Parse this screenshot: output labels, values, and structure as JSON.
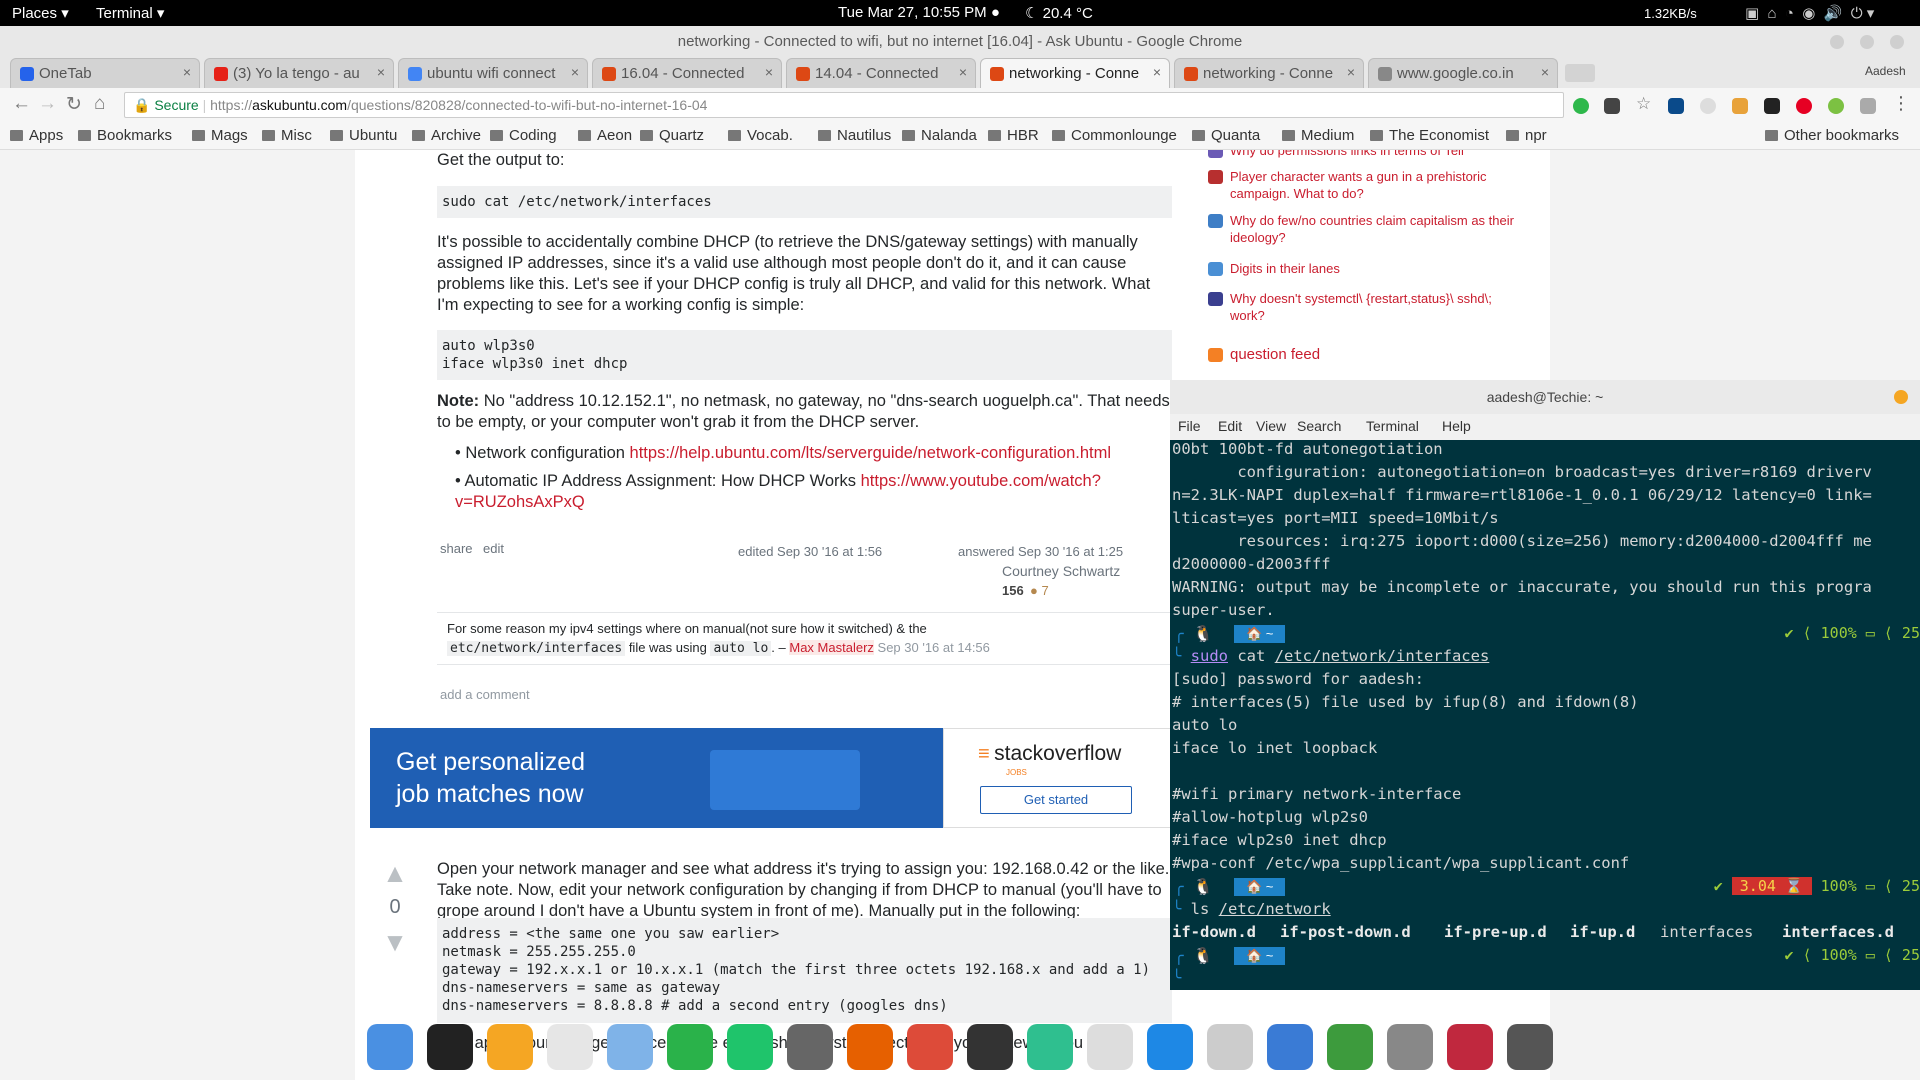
{
  "gnome": {
    "places": "Places ▾",
    "app": "Terminal ▾",
    "clock": "Tue Mar 27, 10:55 PM ●",
    "weather": "☾ 20.4 °C",
    "netspeed": "1.32KB/s"
  },
  "window_title": "networking - Connected to wifi, but no internet [16.04] - Ask Ubuntu - Google Chrome",
  "tabs": [
    {
      "label": "OneTab",
      "color": "#2563eb"
    },
    {
      "label": "(3) Yo la tengo - au",
      "color": "#e62117"
    },
    {
      "label": "ubuntu wifi connect",
      "color": "#4285f4"
    },
    {
      "label": "16.04 - Connected",
      "color": "#dd4814"
    },
    {
      "label": "14.04 - Connected",
      "color": "#dd4814"
    },
    {
      "label": "networking - Conne",
      "color": "#dd4814"
    },
    {
      "label": "networking - Conne",
      "color": "#dd4814"
    },
    {
      "label": "www.google.co.in",
      "color": "#888888"
    }
  ],
  "profile": "Aadesh",
  "omnibox": {
    "secure": "Secure",
    "scheme": "https://",
    "host": "askubuntu.com",
    "path": "/questions/820828/connected-to-wifi-but-no-internet-16-04"
  },
  "bookmarks": [
    "Apps",
    "Bookmarks",
    "Mags",
    "Misc",
    "Ubuntu",
    "Archive",
    "Coding",
    "Aeon",
    "Quartz",
    "Vocab.",
    "Nautilus",
    "Nalanda",
    "HBR",
    "Commonlounge",
    "Quanta",
    "Medium",
    "The Economist",
    "npr"
  ],
  "other_bookmarks": "Other bookmarks",
  "answer1": {
    "intro": "Get the output to:",
    "cmd": "sudo cat /etc/network/interfaces",
    "para1": "It's possible to accidentally combine DHCP (to retrieve the DNS/gateway settings) with manually assigned IP addresses, since it's a valid use although most people don't do it, and it can cause problems like this. Let's see if your DHCP config is truly all DHCP, and valid for this network. What I'm expecting to see for a working config is simple:",
    "config": "auto wlp3s0\niface wlp3s0 inet dhcp",
    "note_label": "Note:",
    "note": " No \"address 10.12.152.1\", no netmask, no gateway, no \"dns-search uoguelph.ca\". That needs to be empty, or your computer won't grab it from the DHCP server.",
    "bullet1_text": "Network configuration ",
    "bullet1_link": "https://help.ubuntu.com/lts/serverguide/network-configuration.html",
    "bullet2_text": "Automatic IP Address Assignment: How DHCP Works ",
    "bullet2_link": "https://www.youtube.com/watch?v=RUZohsAxPxQ",
    "share": "share",
    "edit": "edit",
    "edited": "edited Sep 30 '16 at 1:56",
    "answered": "answered Sep 30 '16 at 1:25",
    "author": "Courtney Schwartz",
    "rep": "156",
    "bronze": "● 7",
    "comment_text": "For some reason my ipv4 settings where on manual(not sure how it switched) & the",
    "comment_code1": "etc/network/interfaces",
    "comment_mid": "file was using",
    "comment_code2": "auto lo",
    "comment_dash": ". –",
    "comment_user": "Max Mastalerz",
    "comment_date": "Sep 30 '16 at 14:56",
    "add_comment": "add a comment"
  },
  "ad": {
    "headline": "Get personalized job matches now",
    "brand": "stackoverflow",
    "sub": "JOBS",
    "cta": "Get started"
  },
  "answer2": {
    "votes": "0",
    "para": "Open your network manager and see what address it's trying to assign you: 192.168.0.42 or the like. Take note. Now, edit your network configuration by changing if from DHCP to manual (you'll have to grope around I don't have a Ubuntu system in front of me). Manually put in the following:",
    "code": "address = <the same one you saw earlier>\nnetmask = 255.255.255.0\ngateway = 192.x.x.1 or 10.x.x.1 (match the first three octets 192.168.x and add a 1)\ndns-nameservers = same as gateway\ndns-nameservers = 8.8.8.8 # add a second entry (googles dns)",
    "after": "Now apply your changes. Once you've establish the first connection to your gateway you can"
  },
  "sidebar": {
    "items": [
      {
        "text": "Why do permissions links in terms of Tell",
        "color": "#6b5ab5"
      },
      {
        "text": "Player character wants a gun in a prehistoric campaign. What to do?",
        "color": "#b72f2f"
      },
      {
        "text": "Why do few/no countries claim capitalism as their ideology?",
        "color": "#3e7ec6"
      },
      {
        "text": "Digits in their lanes",
        "color": "#4a8fd4"
      },
      {
        "text": "Why doesn't systemctl\\ {restart,status}\\ sshd\\; work?",
        "color": "#3a3f8f"
      }
    ],
    "feed": "question feed"
  },
  "terminal": {
    "title": "aadesh@Techie: ~",
    "menu": [
      "File",
      "Edit",
      "View",
      "Search",
      "Terminal",
      "Help"
    ],
    "lines": [
      "00bt 100bt-fd autonegotiation",
      "       configuration: autonegotiation=on broadcast=yes driver=r8169 driverv",
      "n=2.3LK-NAPI duplex=half firmware=rtl8106e-1_0.0.1 06/29/12 latency=0 link=",
      "lticast=yes port=MII speed=10Mbit/s",
      "       resources: irq:275 ioport:d000(size=256) memory:d2004000-d2004fff me",
      "d2000000-d2003fff",
      "WARNING: output may be incomplete or inaccurate, you should run this progra",
      "super-user."
    ],
    "prompt_home": "🏠 ~",
    "status1": "✔ ⟨ 100% ▭ ⟨ 25",
    "cmd1_sudo": "sudo",
    "cmd1_rest": " cat ",
    "cmd1_path": "/etc/network/interfaces",
    "out1": [
      "[sudo] password for aadesh:",
      "# interfaces(5) file used by ifup(8) and ifdown(8)",
      "auto lo",
      "iface lo inet loopback",
      "",
      "#wifi primary network-interface",
      "#allow-hotplug wlp2s0",
      "#iface wlp2s0 inet dhcp",
      "#wpa-conf /etc/wpa_supplicant/wpa_supplicant.conf"
    ],
    "status2_load": "3.04 ⌛",
    "status2_rest": "100% ▭ ⟨ 25",
    "cmd2": "ls ",
    "cmd2_path": "/etc/network",
    "out2": [
      "if-down.d",
      "if-post-down.d",
      "if-pre-up.d",
      "if-up.d",
      "interfaces",
      "interfaces.d"
    ],
    "status3": "✔ ⟨ 100% ▭ ⟨ 25"
  },
  "dock": [
    {
      "name": "finder-icon",
      "color": "#4a90e2"
    },
    {
      "name": "terminal-icon",
      "color": "#222222"
    },
    {
      "name": "orange-icon",
      "color": "#f5a623"
    },
    {
      "name": "tux-icon",
      "color": "#e6e6e6"
    },
    {
      "name": "mail-icon",
      "color": "#7fb3e8"
    },
    {
      "name": "cloud-icon",
      "color": "#2ab24a"
    },
    {
      "name": "upload-icon",
      "color": "#1fc46b"
    },
    {
      "name": "settings-icon",
      "color": "#666666"
    },
    {
      "name": "firefox-icon",
      "color": "#e66000"
    },
    {
      "name": "chrome-icon",
      "color": "#dd4b39"
    },
    {
      "name": "window-icon",
      "color": "#333333"
    },
    {
      "name": "atom-icon",
      "color": "#2fbf8f"
    },
    {
      "name": "appstore-icon",
      "color": "#dddddd"
    },
    {
      "name": "download-icon",
      "color": "#1e88e5"
    },
    {
      "name": "trash-icon",
      "color": "#cccccc"
    },
    {
      "name": "screen-icon",
      "color": "#3a7bd5"
    },
    {
      "name": "ball-icon",
      "color": "#3d9b3d"
    },
    {
      "name": "scissors-icon",
      "color": "#888888"
    },
    {
      "name": "installer-icon",
      "color": "#c0283e"
    },
    {
      "name": "gear-icon",
      "color": "#555555"
    }
  ]
}
